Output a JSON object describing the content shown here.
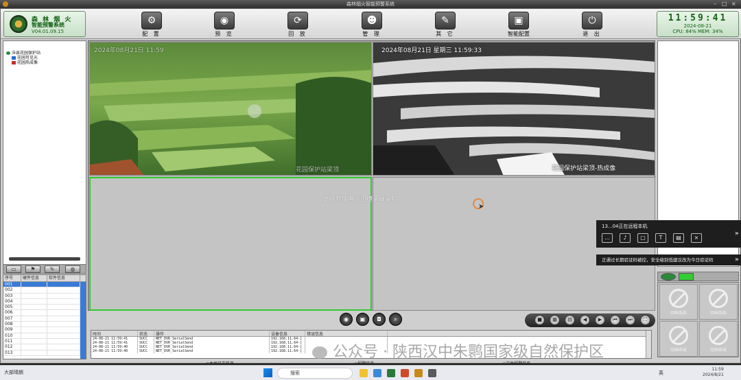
{
  "window": {
    "title": "森林烟火智能预警系统"
  },
  "logo": {
    "title": "森 林 烟 火",
    "subtitle": "智能预警系统",
    "version": "V04.01.09.15"
  },
  "toolbar": [
    {
      "label": "配 置",
      "icon": "gear-icon",
      "glyph": "⚙"
    },
    {
      "label": "预 览",
      "icon": "camera-icon",
      "glyph": "◉"
    },
    {
      "label": "回 放",
      "icon": "playback-icon",
      "glyph": "⟳"
    },
    {
      "label": "管 理",
      "icon": "users-icon",
      "glyph": "☻"
    },
    {
      "label": "其 它",
      "icon": "tools-icon",
      "glyph": "✎"
    },
    {
      "label": "智能配置",
      "icon": "smart-config-icon",
      "glyph": "▣"
    },
    {
      "label": "退 出",
      "icon": "power-icon",
      "glyph": "⏻"
    }
  ],
  "clock": {
    "time": "11:59:41",
    "date": "2024-08-21",
    "stats": "CPU: 84%  MEM: 34%"
  },
  "tree": {
    "root": "沣县花园保护站",
    "children": [
      "花园可见光",
      "花园热成像"
    ]
  },
  "device_list": {
    "headers": [
      "序号",
      "硬件信息",
      "软件信息"
    ],
    "rows": [
      "001",
      "002",
      "003",
      "004",
      "005",
      "006",
      "007",
      "008",
      "009",
      "010",
      "011",
      "012",
      "013"
    ]
  },
  "video": {
    "cam1_timestamp": "2024年08月21日 11:59",
    "cam1_label": "花园保护站梁顶",
    "cam2_timestamp": "2024年08月21日  星期三  11:59:33",
    "cam2_label": "花园保护站梁顶-热成像",
    "overlay_watermark": "此视频使用@迅捷录屏录制"
  },
  "remote_popup": {
    "title": "13...04正在远程本机",
    "notice": "正通过长期验证码被控，安全级别低建议改为今日验证码"
  },
  "stop_buttons": [
    "动画系统",
    "动画系统",
    "动画系统",
    "动画系统"
  ],
  "log": {
    "headers": [
      "时间",
      "状态",
      "操作",
      "设备信息",
      "错误信息"
    ],
    "rows": [
      {
        "time": "24-08-21 11:59:41",
        "status": "SUCC",
        "op": "NET_DVR_SerialSend",
        "dev": "192.168.11.64-[",
        "err": ""
      },
      {
        "time": "24-08-21 11:59:41",
        "status": "SUCC",
        "op": "NET_DVR_SerialSend",
        "dev": "192.168.11.64-[",
        "err": ""
      },
      {
        "time": "24-08-21 11:59:40",
        "status": "SUCC",
        "op": "NET_DVR_SerialSend",
        "dev": "192.168.11.64-[",
        "err": ""
      },
      {
        "time": "24-08-21 11:59:40",
        "status": "SUCC",
        "op": "NET_DVR_SerialSend",
        "dev": "192.168.11.64-[",
        "err": ""
      }
    ],
    "footer": [
      "⊙本地日志信息",
      "○报警信息",
      "○文件报警信息"
    ]
  },
  "watermark": {
    "text": "公众号 · 陕西汉中朱鹮国家级自然保护区"
  },
  "taskbar": {
    "weather": "大部晴朗",
    "search": "搜索",
    "tray": "英",
    "time": "11:59",
    "date": "2024/8/21"
  }
}
